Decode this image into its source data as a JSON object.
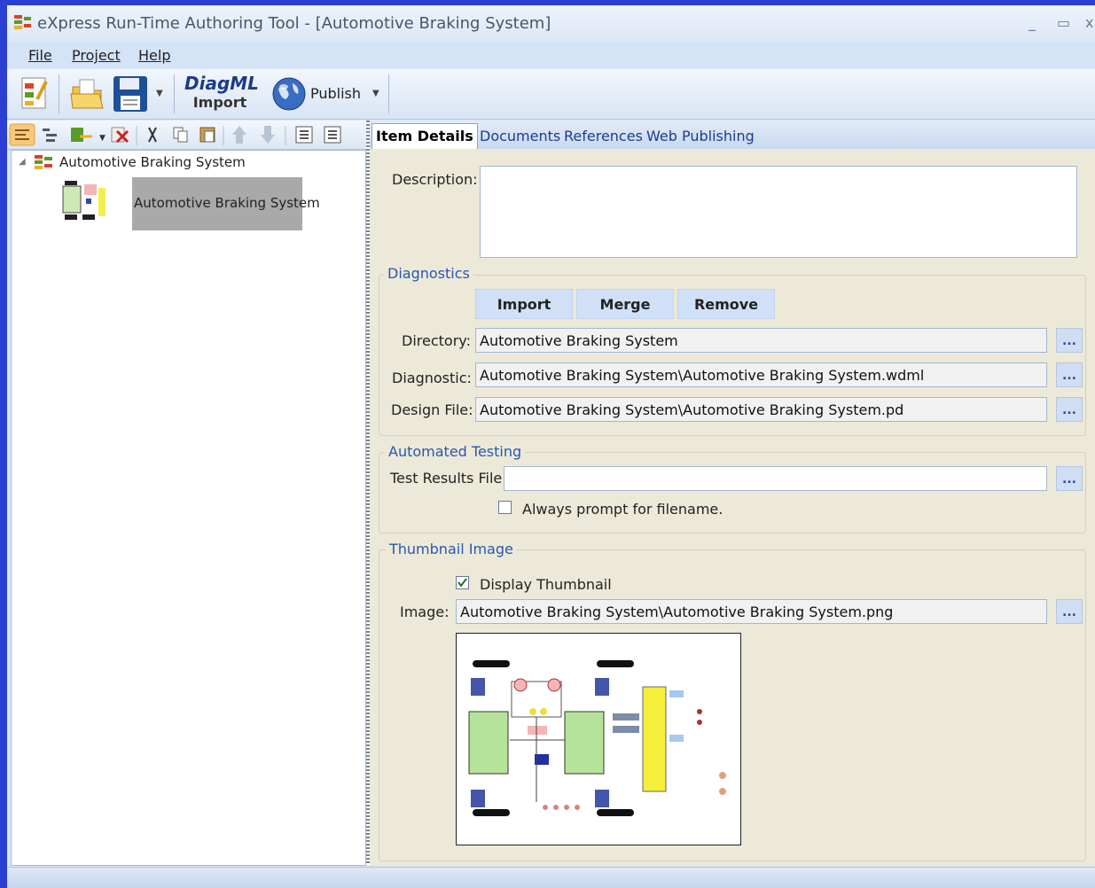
{
  "window": {
    "title": "eXpress Run-Time Authoring Tool - [Automotive Braking System]",
    "controls": [
      "_",
      "▭",
      "x"
    ]
  },
  "menu": [
    {
      "label": "File"
    },
    {
      "label": "Project"
    },
    {
      "label": "Help"
    }
  ],
  "toolbar": {
    "diagml_line1": "DiagML",
    "diagml_line2": "Import",
    "publish_label": "Publish",
    "icons": [
      "new-project-icon",
      "open-project-icon",
      "save-icon",
      "dropdown-arrow-icon",
      "diagml-import-icon",
      "publish-globe-icon",
      "publish-dropdown-icon"
    ]
  },
  "tree": {
    "root_label": "Automotive Braking System",
    "child_label": "Automotive Braking System"
  },
  "tabs": [
    {
      "label": "Item Details",
      "active": true
    },
    {
      "label": "Documents"
    },
    {
      "label": "References"
    },
    {
      "label": "Web Publishing"
    }
  ],
  "details": {
    "description_label": "Description:",
    "description_value": "",
    "diagnostics": {
      "title": "Diagnostics",
      "import_label": "Import",
      "merge_label": "Merge",
      "remove_label": "Remove",
      "directory_label": "Directory:",
      "directory_value": "Automotive Braking System",
      "diagnostic_label": "Diagnostic:",
      "diagnostic_value": "Automotive Braking System\\Automotive Braking System.wdml",
      "design_label": "Design File:",
      "design_value": "Automotive Braking System\\Automotive Braking System.pd"
    },
    "testing": {
      "title": "Automated Testing",
      "results_label": "Test Results File:",
      "results_value": "",
      "prompt_label": "Always prompt for filename.",
      "prompt_checked": false
    },
    "thumbnail": {
      "title": "Thumbnail Image",
      "display_label": "Display Thumbnail",
      "display_checked": true,
      "image_label": "Image:",
      "image_value": "Automotive Braking System\\Automotive Braking System.png"
    },
    "browse_label": "..."
  },
  "colors": {
    "accent": "#2957b0",
    "panel": "#ece9d8",
    "desktop": "#2b3fd0"
  }
}
